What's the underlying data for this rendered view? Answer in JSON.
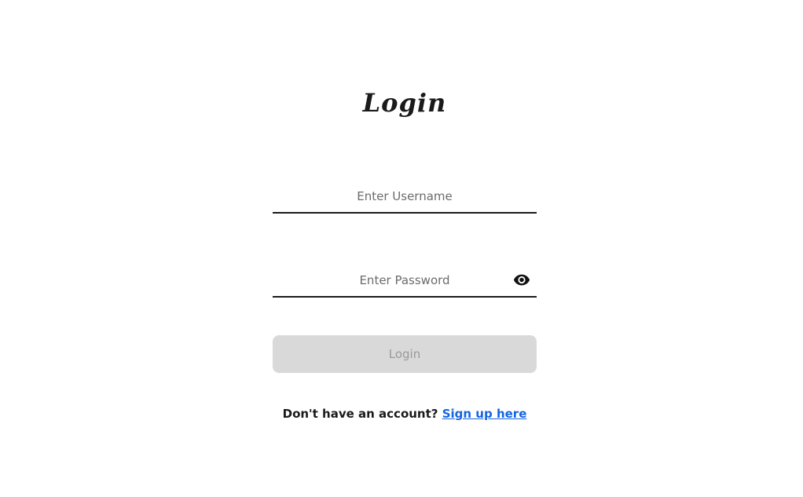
{
  "login_form": {
    "title": "Login",
    "username": {
      "placeholder": "Enter Username",
      "value": ""
    },
    "password": {
      "placeholder": "Enter Password",
      "value": "",
      "toggle_icon": "eye-icon"
    },
    "submit_label": "Login",
    "submit_disabled": true,
    "signup_prompt": "Don't have an account?",
    "signup_link": "Sign up here"
  },
  "colors": {
    "text": "#1a1a1a",
    "link": "#1565e0",
    "button_disabled_bg": "#d9d9d9",
    "button_disabled_text": "#9a9a9a"
  }
}
